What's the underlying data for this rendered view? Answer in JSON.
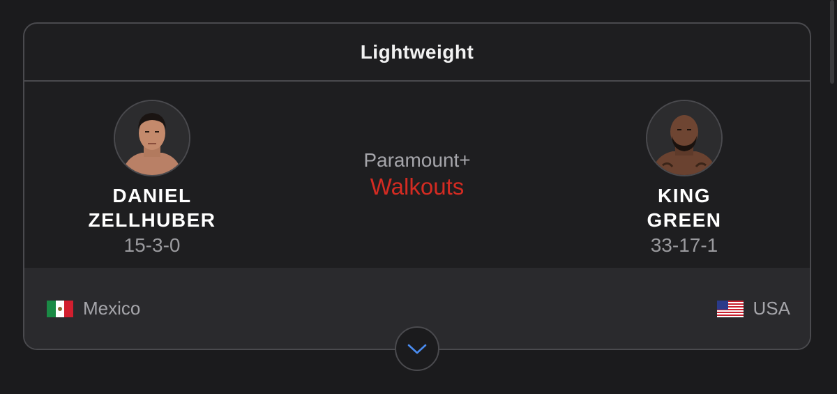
{
  "bout": {
    "weight_class": "Lightweight",
    "broadcast": {
      "provider": "Paramount+",
      "label": "Walkouts",
      "label_color": "#d42b22"
    }
  },
  "fighters": {
    "left": {
      "first_name": "DANIEL",
      "last_name": "ZELLHUBER",
      "record": "15-3-0",
      "country": "Mexico",
      "flag_icon": "mexico-flag-icon"
    },
    "right": {
      "first_name": "KING",
      "last_name": "GREEN",
      "record": "33-17-1",
      "country": "USA",
      "flag_icon": "usa-flag-icon"
    }
  },
  "expand_icon": "chevron-down-icon",
  "colors": {
    "background": "#1b1b1d",
    "card_border": "#4a4a4e",
    "footer": "#2a2a2d",
    "chevron": "#4a8cf0"
  }
}
